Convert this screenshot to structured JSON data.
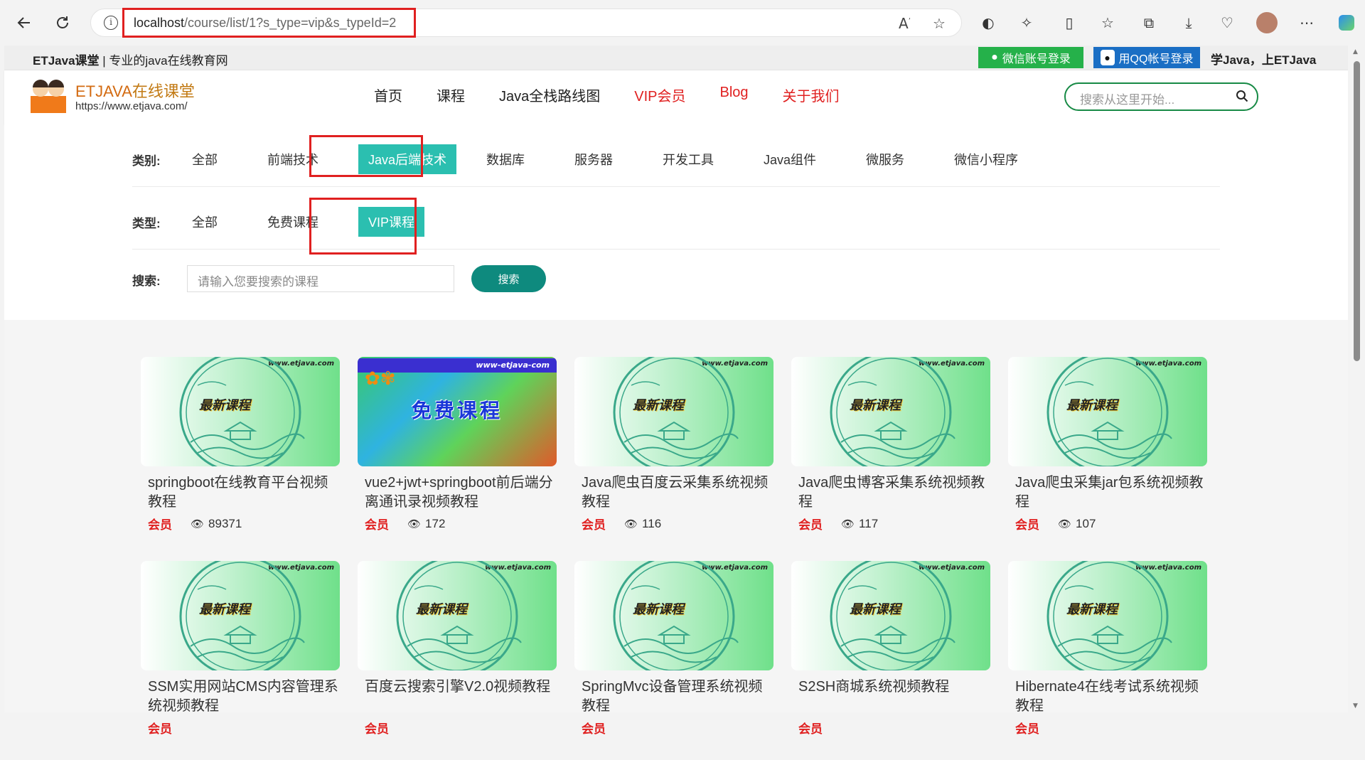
{
  "browser": {
    "url_host": "localhost",
    "url_path": "/course/list/1?s_type=vip&s_typeId=2"
  },
  "topbar": {
    "brand_bold": "ETJava课堂",
    "brand_rest": " | 专业的java在线教育网",
    "wechat_login": "微信账号登录",
    "qq_login": "用QQ帐号登录",
    "slogan": "学Java，上ETJava"
  },
  "header": {
    "logo_title_en": "ETJAVA",
    "logo_title_cn": "在线课堂",
    "logo_url": "https://www.etjava.com/",
    "menu": [
      {
        "label": "首页",
        "red": false
      },
      {
        "label": "课程",
        "red": false
      },
      {
        "label": "Java全栈路线图",
        "red": false
      },
      {
        "label": "VIP会员",
        "red": true
      },
      {
        "label": "Blog",
        "red": true
      },
      {
        "label": "关于我们",
        "red": true
      }
    ],
    "search_placeholder": "搜索从这里开始..."
  },
  "filters": {
    "category_label": "类别:",
    "categories": [
      "全部",
      "前端技术",
      "Java后端技术",
      "数据库",
      "服务器",
      "开发工具",
      "Java组件",
      "微服务",
      "微信小程序"
    ],
    "category_active": "Java后端技术",
    "type_label": "类型:",
    "types": [
      "全部",
      "免费课程",
      "VIP课程"
    ],
    "type_active": "VIP课程",
    "search_label": "搜索:",
    "search_placeholder": "请输入您要搜索的课程",
    "search_button": "搜索"
  },
  "thumb_text": {
    "watermark": "www.etjava.com",
    "newest": "最新课程",
    "free_watermark": "www-etjava-com",
    "free": "免费课程"
  },
  "courses": [
    {
      "title": "springboot在线教育平台视频教程",
      "tag": "会员",
      "views": "89371",
      "thumb": "new"
    },
    {
      "title": "vue2+jwt+springboot前后端分离通讯录视频教程",
      "tag": "会员",
      "views": "172",
      "thumb": "free"
    },
    {
      "title": "Java爬虫百度云采集系统视频教程",
      "tag": "会员",
      "views": "116",
      "thumb": "new"
    },
    {
      "title": "Java爬虫博客采集系统视频教程",
      "tag": "会员",
      "views": "117",
      "thumb": "new"
    },
    {
      "title": "Java爬虫采集jar包系统视频教程",
      "tag": "会员",
      "views": "107",
      "thumb": "new"
    },
    {
      "title": "SSM实用网站CMS内容管理系统视频教程",
      "tag": "会员",
      "views": "",
      "thumb": "new"
    },
    {
      "title": "百度云搜索引擎V2.0视频教程",
      "tag": "会员",
      "views": "",
      "thumb": "new"
    },
    {
      "title": "SpringMvc设备管理系统视频教程",
      "tag": "会员",
      "views": "",
      "thumb": "new"
    },
    {
      "title": "S2SH商城系统视频教程",
      "tag": "会员",
      "views": "",
      "thumb": "new"
    },
    {
      "title": "Hibernate4在线考试系统视频教程",
      "tag": "会员",
      "views": "",
      "thumb": "new"
    }
  ]
}
